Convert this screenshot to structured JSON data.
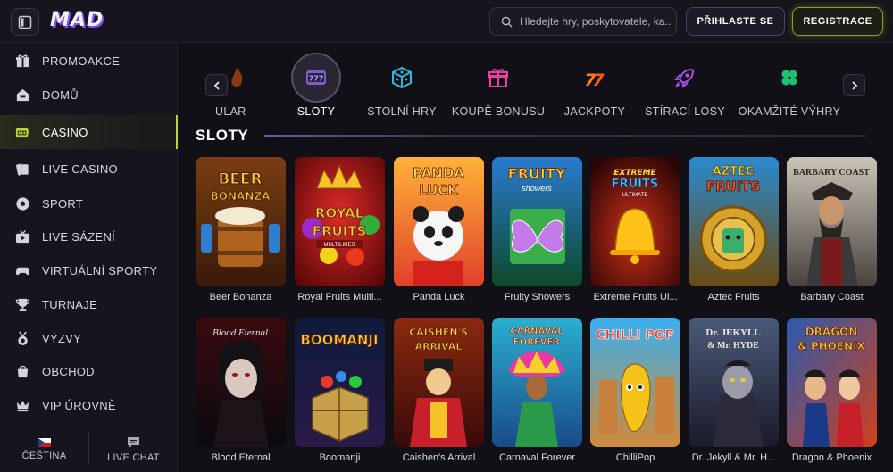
{
  "header": {
    "logo": "MAD",
    "search_placeholder": "Hledejte hry, poskytovatele, ka...",
    "login_label": "PŘIHLASTE SE",
    "register_label": "REGISTRACE"
  },
  "sidebar": {
    "items": [
      {
        "label": "PROMOAKCE",
        "icon": "gift-icon"
      },
      {
        "label": "DOMŮ",
        "icon": "home-icon"
      },
      {
        "label": "CASINO",
        "icon": "slot-machine-icon",
        "active": true
      },
      {
        "label": "LIVE CASINO",
        "icon": "cards-icon"
      },
      {
        "label": "SPORT",
        "icon": "soccer-ball-icon"
      },
      {
        "label": "LIVE SÁZENÍ",
        "icon": "tv-icon"
      },
      {
        "label": "VIRTUÁLNÍ SPORTY",
        "icon": "gamepad-icon"
      },
      {
        "label": "TURNAJE",
        "icon": "trophy-icon"
      },
      {
        "label": "VÝZVY",
        "icon": "medal-icon"
      },
      {
        "label": "OBCHOD",
        "icon": "shop-icon"
      },
      {
        "label": "VIP ÚROVNĚ",
        "icon": "crown-icon"
      }
    ],
    "language_label": "ČEŠTINA",
    "chat_label": "LIVE CHAT"
  },
  "categories": [
    {
      "label": "PULAR",
      "icon": "flame-icon"
    },
    {
      "label": "SLOTY",
      "icon": "slot-777-icon",
      "selected": true
    },
    {
      "label": "STOLNÍ HRY",
      "icon": "dice-icon"
    },
    {
      "label": "KOUPĚ BONUSU",
      "icon": "gift-box-icon"
    },
    {
      "label": "JACKPOTY",
      "icon": "seven-icon"
    },
    {
      "label": "STÍRACÍ LOSY",
      "icon": "rocket-icon"
    },
    {
      "label": "OKAMŽITÉ VÝHRY",
      "icon": "clover-icon"
    }
  ],
  "section_title": "SLOTY",
  "games": [
    {
      "title": "Beer Bonanza",
      "art": "BEER BONANZA"
    },
    {
      "title": "Royal Fruits Multi...",
      "art": "ROYAL FRUITS"
    },
    {
      "title": "Panda Luck",
      "art": "PANDA LUCK"
    },
    {
      "title": "Fruity Showers",
      "art": "FRUITY showers"
    },
    {
      "title": "Extreme Fruits Ul...",
      "art": "EXTREME FRUITS"
    },
    {
      "title": "Aztec Fruits",
      "art": "AZTEC FRUITS"
    },
    {
      "title": "Barbary Coast",
      "art": "BARBARY COAST"
    },
    {
      "title": "Blood Eternal",
      "art": "Blood Eternal"
    },
    {
      "title": "Boomanji",
      "art": "BOOMANJI"
    },
    {
      "title": "Caishen's Arrival",
      "art": "CAISHEN'S ARRIVAL"
    },
    {
      "title": "Carnaval Forever",
      "art": "CARNAVAL FOREVER"
    },
    {
      "title": "ChilliPop",
      "art": "CHILLI POP"
    },
    {
      "title": "Dr. Jekyll & Mr. H...",
      "art": "Dr. JEKYLL & Mr. HYDE"
    },
    {
      "title": "Dragon & Phoenix",
      "art": "DRAGON & PHOENIX"
    }
  ],
  "colors": {
    "accent": "#b5d53c",
    "background": "#121017",
    "sidebar": "#16141c"
  }
}
